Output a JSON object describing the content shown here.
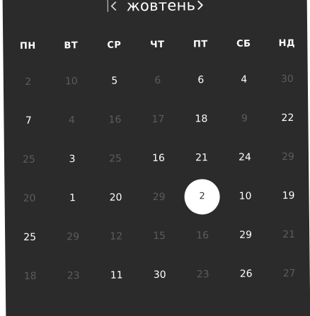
{
  "calendar": {
    "month": "жовтень",
    "prev_icon": "chevron-left-icon",
    "next_icon": "chevron-right-icon",
    "weekdays": [
      "ПН",
      "ВТ",
      "СР",
      "ЧТ",
      "ПТ",
      "СБ",
      "НД"
    ],
    "colors": {
      "background": "#2b2b2b",
      "text": "#ffffff",
      "muted": "#5c5c5c",
      "selected_bg": "#ffffff",
      "selected_text": "#333333"
    },
    "weeks": [
      [
        {
          "label": "2",
          "state": "muted"
        },
        {
          "label": "10",
          "state": "muted"
        },
        {
          "label": "5",
          "state": "current"
        },
        {
          "label": "6",
          "state": "muted"
        },
        {
          "label": "6",
          "state": "current"
        },
        {
          "label": "4",
          "state": "current"
        },
        {
          "label": "30",
          "state": "muted"
        }
      ],
      [
        {
          "label": "7",
          "state": "current"
        },
        {
          "label": "4",
          "state": "muted"
        },
        {
          "label": "16",
          "state": "muted"
        },
        {
          "label": "17",
          "state": "muted"
        },
        {
          "label": "18",
          "state": "current"
        },
        {
          "label": "9",
          "state": "muted"
        },
        {
          "label": "22",
          "state": "current"
        }
      ],
      [
        {
          "label": "25",
          "state": "muted"
        },
        {
          "label": "3",
          "state": "current"
        },
        {
          "label": "25",
          "state": "muted"
        },
        {
          "label": "16",
          "state": "current"
        },
        {
          "label": "21",
          "state": "current"
        },
        {
          "label": "24",
          "state": "current"
        },
        {
          "label": "29",
          "state": "muted"
        }
      ],
      [
        {
          "label": "20",
          "state": "muted"
        },
        {
          "label": "1",
          "state": "current"
        },
        {
          "label": "20",
          "state": "current"
        },
        {
          "label": "29",
          "state": "muted"
        },
        {
          "label": "2",
          "state": "selected"
        },
        {
          "label": "10",
          "state": "current"
        },
        {
          "label": "19",
          "state": "current"
        }
      ],
      [
        {
          "label": "25",
          "state": "current"
        },
        {
          "label": "29",
          "state": "muted"
        },
        {
          "label": "12",
          "state": "muted"
        },
        {
          "label": "15",
          "state": "muted"
        },
        {
          "label": "16",
          "state": "muted"
        },
        {
          "label": "29",
          "state": "current"
        },
        {
          "label": "21",
          "state": "muted"
        }
      ],
      [
        {
          "label": "18",
          "state": "muted"
        },
        {
          "label": "23",
          "state": "muted"
        },
        {
          "label": "11",
          "state": "current"
        },
        {
          "label": "30",
          "state": "current"
        },
        {
          "label": "23",
          "state": "muted"
        },
        {
          "label": "26",
          "state": "current"
        },
        {
          "label": "27",
          "state": "muted"
        }
      ]
    ]
  }
}
